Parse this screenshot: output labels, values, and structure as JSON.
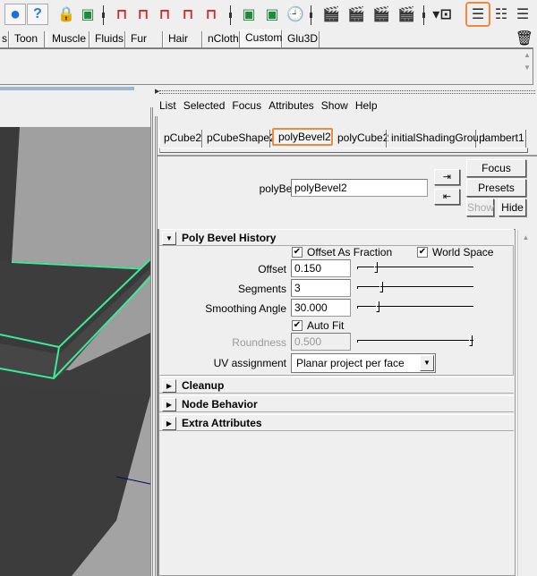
{
  "toolbar": {
    "icons": [
      {
        "name": "sphere-icon",
        "glyph": "●",
        "color": "#1f6fd6",
        "pressed": true
      },
      {
        "name": "help-icon",
        "glyph": "?",
        "color": "#2a7bd1",
        "pressed": true
      },
      {
        "name": "lock-icon",
        "glyph": "🔒",
        "color": "#8b7a2a"
      },
      {
        "name": "select-region-icon",
        "glyph": "▣",
        "color": "#1e8a3c"
      },
      {
        "name": "snap-grid-icon",
        "glyph": "⊓",
        "color": "#d42a2a"
      },
      {
        "name": "snap-curve-icon",
        "glyph": "⊓",
        "color": "#d42a2a"
      },
      {
        "name": "snap-point-icon",
        "glyph": "⊓",
        "color": "#d42a2a"
      },
      {
        "name": "snap-plane-icon",
        "glyph": "⊓",
        "color": "#d42a2a"
      },
      {
        "name": "snap-live-icon",
        "glyph": "⊓",
        "color": "#d42a2a"
      },
      {
        "name": "input-ops-icon",
        "glyph": "▣",
        "color": "#1e8a3c"
      },
      {
        "name": "output-ops-icon",
        "glyph": "▣",
        "color": "#1e8a3c"
      },
      {
        "name": "construction-history-icon",
        "glyph": "🕘",
        "color": "#444"
      },
      {
        "name": "render-view-icon",
        "glyph": "🎬",
        "color": "#222"
      },
      {
        "name": "render-current-icon",
        "glyph": "🎬",
        "color": "#222"
      },
      {
        "name": "ipr-render-icon",
        "glyph": "🎬",
        "color": "#222"
      },
      {
        "name": "render-settings-icon",
        "glyph": "🎬",
        "color": "#222"
      },
      {
        "name": "camera-dropdown-icon",
        "glyph": "▾⊡",
        "color": "#222"
      },
      {
        "name": "attribute-editor-icon",
        "glyph": "☰",
        "color": "#333",
        "highlighted": true
      },
      {
        "name": "tool-settings-icon",
        "glyph": "☷",
        "color": "#333"
      },
      {
        "name": "channel-box-icon",
        "glyph": "☰",
        "color": "#333"
      }
    ],
    "highlight_color": "#f0893a"
  },
  "shelf": {
    "tabs": [
      "s",
      "Toon",
      "Muscle",
      "Fluids",
      "Fur",
      "Hair",
      "nCloth",
      "Custom",
      "Glu3D"
    ],
    "active_tab": "Custom",
    "trash_icon": "trash-icon"
  },
  "attribute_editor": {
    "menu": [
      "List",
      "Selected",
      "Focus",
      "Attributes",
      "Show",
      "Help"
    ],
    "node_tabs": [
      "pCube2",
      "pCubeShape2",
      "polyBevel2",
      "polyCube2",
      "initialShadingGroup",
      "lambert1"
    ],
    "active_node_tab": "polyBevel2",
    "node_type_label": "polyBevel:",
    "node_name": "polyBevel2",
    "buttons": {
      "focus": "Focus",
      "presets": "Presets",
      "show": "Show",
      "hide": "Hide"
    },
    "sections": {
      "history": {
        "title": "Poly Bevel History",
        "expanded": true,
        "offset_as_fraction": {
          "label": "Offset As Fraction",
          "checked": true
        },
        "world_space": {
          "label": "World Space",
          "checked": true
        },
        "offset": {
          "label": "Offset",
          "value": "0.150",
          "slider_fraction": 0.15
        },
        "segments": {
          "label": "Segments",
          "value": "3",
          "slider_fraction": 0.2
        },
        "smoothing_angle": {
          "label": "Smoothing Angle",
          "value": "30.000",
          "slider_fraction": 0.17
        },
        "auto_fit": {
          "label": "Auto Fit",
          "checked": true
        },
        "roundness": {
          "label": "Roundness",
          "value": "0.500",
          "disabled": true,
          "slider_fraction": 1.0
        },
        "uv_assignment": {
          "label": "UV assignment",
          "value": "Planar project per face"
        }
      },
      "collapsed": [
        "Cleanup",
        "Node Behavior",
        "Extra Attributes"
      ]
    }
  },
  "viewport": {
    "wire_color": "#3dea9a",
    "object_color": "#3f3f3f",
    "background_color": "#a0a0a0"
  }
}
